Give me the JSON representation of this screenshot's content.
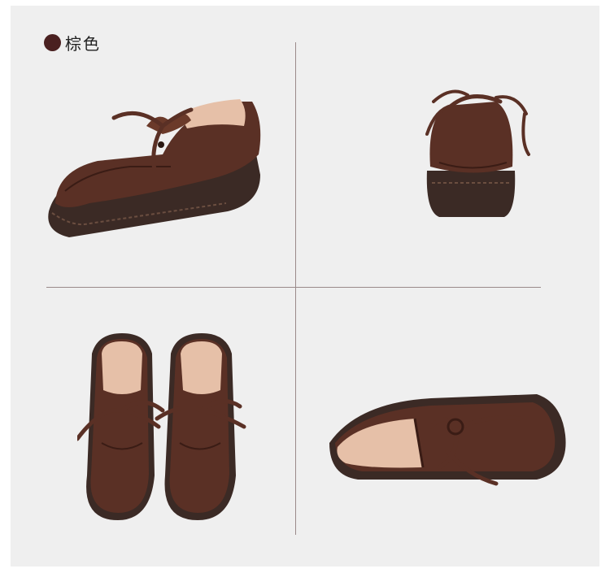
{
  "header": {
    "color_name": "棕色",
    "swatch_color": "#4a2020"
  },
  "views": [
    {
      "id": "side-angle",
      "icon": "shoe-side-angle-image"
    },
    {
      "id": "back",
      "icon": "shoe-back-image"
    },
    {
      "id": "top-pair",
      "icon": "shoe-pair-top-image"
    },
    {
      "id": "sole-side",
      "icon": "shoe-side-tilted-image"
    }
  ],
  "colors": {
    "leather": "#5a3025",
    "leather_dark": "#3a1c15",
    "sole": "#3b2a25",
    "lining": "#e6c0a8",
    "background": "#efefef"
  }
}
